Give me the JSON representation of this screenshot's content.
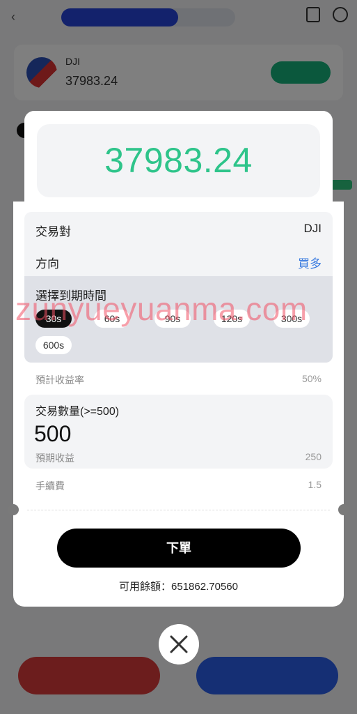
{
  "background": {
    "tab_active": "",
    "tab_other": "",
    "symbol": "DJI",
    "price": "37983.24"
  },
  "modal": {
    "price": "37983.24",
    "pair_label": "交易對",
    "pair_value": "DJI",
    "direction_label": "方向",
    "direction_value": "買多",
    "expiry_title": "選擇到期時間",
    "expiry_options": [
      "30s",
      "60s",
      "90s",
      "120s",
      "300s",
      "600s"
    ],
    "expiry_selected": "30s",
    "yield_label": "預計收益率",
    "yield_value": "50%",
    "quantity_label": "交易數量(>=500)",
    "quantity_value": "500",
    "expected_income_label": "預期收益",
    "expected_income_value": "250",
    "fee_label": "手續費",
    "fee_value": "1.5",
    "order_button": "下單",
    "balance_label": "可用餘額：651862.70560"
  },
  "watermark": "zunyueyuanma.com",
  "colors": {
    "price_green": "#2ec48a",
    "direction_blue": "#3a7be0",
    "primary_button": "#000000",
    "watermark": "#f05064"
  },
  "icons": {
    "close": "close-icon"
  }
}
